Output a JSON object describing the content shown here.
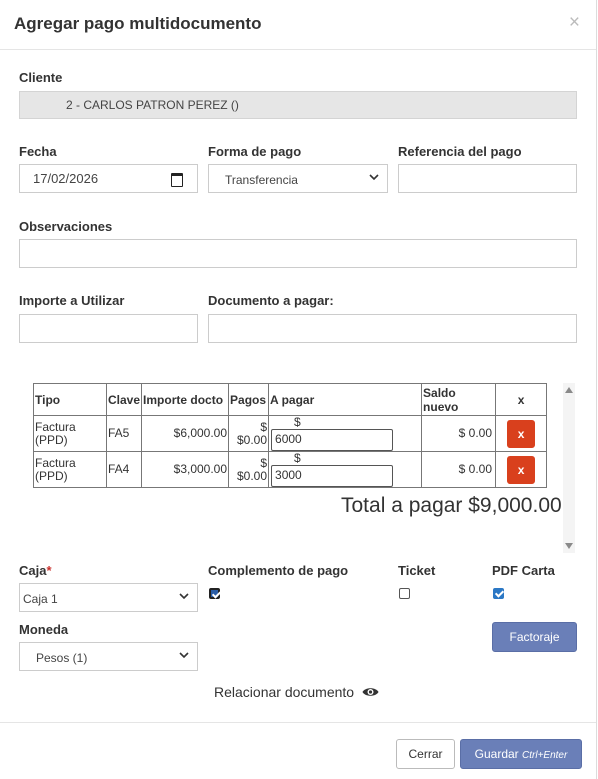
{
  "modal": {
    "title": "Agregar pago multidocumento",
    "close": "×"
  },
  "cliente": {
    "label": "Cliente",
    "value": "2 - CARLOS PATRON PEREZ ()"
  },
  "fecha": {
    "label": "Fecha",
    "value": "17/02/2026"
  },
  "forma_pago": {
    "label": "Forma de pago",
    "value": "Transferencia"
  },
  "referencia": {
    "label": "Referencia del pago",
    "value": ""
  },
  "observaciones": {
    "label": "Observaciones",
    "value": ""
  },
  "importe": {
    "label": "Importe a Utilizar",
    "value": ""
  },
  "documento": {
    "label": "Documento a pagar:",
    "value": ""
  },
  "table": {
    "headers": {
      "tipo": "Tipo",
      "clave": "Clave",
      "importe": "Importe docto",
      "pagos": "Pagos",
      "apagar": "A pagar",
      "saldo": "Saldo nuevo",
      "x": "x"
    },
    "rows": [
      {
        "tipo": "Factura (PPD)",
        "clave": "FA5",
        "importe": "$6,000.00",
        "pagos": "$ $0.00",
        "currency": "$",
        "apagar": "6000",
        "saldo": "$ 0.00",
        "remove": "x"
      },
      {
        "tipo": "Factura (PPD)",
        "clave": "FA4",
        "importe": "$3,000.00",
        "pagos": "$ $0.00",
        "currency": "$",
        "apagar": "3000",
        "saldo": "$ 0.00",
        "remove": "x"
      }
    ]
  },
  "total": "Total a pagar $9,000.00",
  "caja": {
    "label": "Caja",
    "required": "*",
    "value": "Caja 1"
  },
  "moneda": {
    "label": "Moneda",
    "value": "Pesos (1)"
  },
  "complemento": {
    "label": "Complemento de pago",
    "checked": true
  },
  "ticket": {
    "label": "Ticket",
    "checked": false
  },
  "pdf_carta": {
    "label": "PDF Carta",
    "checked": true
  },
  "factoraje_label": "Factoraje",
  "relacionar_label": "Relacionar documento",
  "footer": {
    "cerrar_label": "Cerrar",
    "guardar_label": "Guardar",
    "guardar_shortcut": "Ctrl+Enter"
  },
  "colors": {
    "primary_button": "#6a7fb8",
    "danger_button": "#d9401d",
    "checkbox_checked": "#2b78c5",
    "readonly_bg": "#e6e6e6"
  },
  "icons": [
    "close-icon",
    "calendar-icon",
    "chevron-down-icon",
    "remove-icon",
    "eye-icon",
    "scroll-up-icon",
    "scroll-down-icon"
  ]
}
